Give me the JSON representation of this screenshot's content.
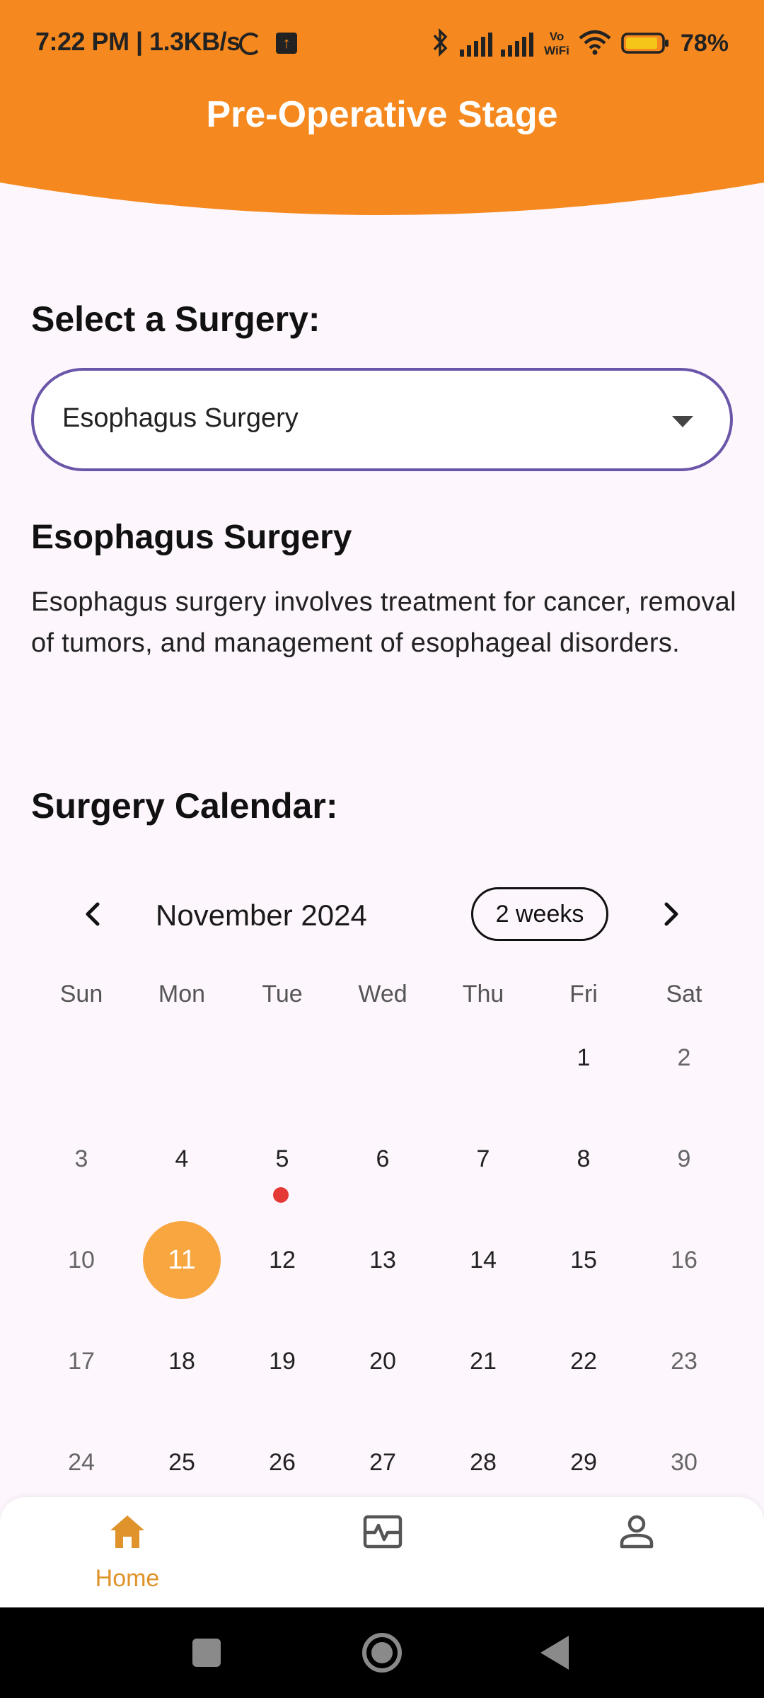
{
  "colors": {
    "header": "#F5891F",
    "accent": "#F8A640",
    "select_border": "#6A55A8",
    "event_dot": "#E53935",
    "nav_active": "#E0932A",
    "background": "#FDF6FD"
  },
  "status_bar": {
    "time": "7:22 PM | 1.3KB/s",
    "battery": "78%",
    "icons": [
      "loading-icon",
      "upload-icon",
      "bluetooth-icon",
      "signal-icon",
      "signal-icon",
      "vowifi-icon",
      "wifi-icon",
      "battery-icon"
    ],
    "vowifi_label": "Vo WiFi"
  },
  "header": {
    "title": "Pre-Operative Stage"
  },
  "select": {
    "heading": "Select a Surgery:",
    "value": "Esophagus Surgery"
  },
  "surgery": {
    "title": "Esophagus Surgery",
    "description": "Esophagus surgery involves treatment for cancer, removal of tumors, and management of esophageal disorders."
  },
  "calendar": {
    "heading": "Surgery Calendar:",
    "month": "November 2024",
    "format_button": "2 weeks",
    "weekdays": [
      "Sun",
      "Mon",
      "Tue",
      "Wed",
      "Thu",
      "Fri",
      "Sat"
    ],
    "weeks": [
      [
        "",
        "",
        "",
        "",
        "",
        "1",
        "2"
      ],
      [
        "3",
        "4",
        "5",
        "6",
        "7",
        "8",
        "9"
      ],
      [
        "10",
        "11",
        "12",
        "13",
        "14",
        "15",
        "16"
      ],
      [
        "17",
        "18",
        "19",
        "20",
        "21",
        "22",
        "23"
      ],
      [
        "24",
        "25",
        "26",
        "27",
        "28",
        "29",
        "30"
      ]
    ],
    "selected_day": "11",
    "event_days": [
      "5"
    ]
  },
  "bottom_nav": {
    "items": [
      {
        "label": "Home",
        "icon": "home-icon",
        "active": true
      },
      {
        "label": "",
        "icon": "monitor-heart-icon",
        "active": false
      },
      {
        "label": "",
        "icon": "person-icon",
        "active": false
      }
    ]
  },
  "system_nav": [
    "recents-icon",
    "home-circle-icon",
    "back-icon"
  ]
}
